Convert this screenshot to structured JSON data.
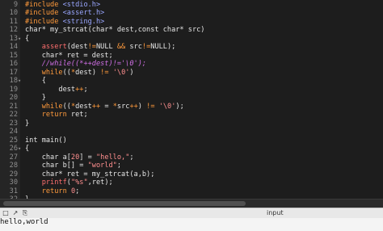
{
  "editor": {
    "lines": [
      {
        "n": "9",
        "fold": "",
        "tokens": [
          [
            "pre",
            "#include "
          ],
          [
            "inc",
            "<stdio.h>"
          ]
        ]
      },
      {
        "n": "10",
        "fold": "",
        "tokens": [
          [
            "pre",
            "#include "
          ],
          [
            "inc",
            "<assert.h>"
          ]
        ]
      },
      {
        "n": "11",
        "fold": "",
        "tokens": [
          [
            "pre",
            "#include "
          ],
          [
            "inc",
            "<string.h>"
          ]
        ]
      },
      {
        "n": "12",
        "fold": "",
        "tokens": [
          [
            "plain",
            "char* my_strcat(char* dest,const char* src)"
          ]
        ]
      },
      {
        "n": "13",
        "fold": "▾",
        "tokens": [
          [
            "plain",
            "{"
          ]
        ]
      },
      {
        "n": "14",
        "fold": "",
        "tokens": [
          [
            "plain",
            "    "
          ],
          [
            "fn",
            "assert"
          ],
          [
            "plain",
            "(dest"
          ],
          [
            "kw",
            "!="
          ],
          [
            "plain",
            "NULL "
          ],
          [
            "kw",
            "&&"
          ],
          [
            "plain",
            " src"
          ],
          [
            "kw",
            "!="
          ],
          [
            "plain",
            "NULL);"
          ]
        ]
      },
      {
        "n": "15",
        "fold": "",
        "tokens": [
          [
            "plain",
            "    char* ret = dest;"
          ]
        ]
      },
      {
        "n": "16",
        "fold": "",
        "tokens": [
          [
            "plain",
            "    "
          ],
          [
            "cmt",
            "//while((*++dest)!='\\0');"
          ]
        ]
      },
      {
        "n": "17",
        "fold": "",
        "tokens": [
          [
            "plain",
            "    "
          ],
          [
            "kw",
            "while"
          ],
          [
            "plain",
            "(("
          ],
          [
            "kw",
            "*"
          ],
          [
            "plain",
            "dest) "
          ],
          [
            "kw",
            "!="
          ],
          [
            "plain",
            " "
          ],
          [
            "str",
            "'\\0'"
          ],
          [
            "plain",
            ")"
          ]
        ]
      },
      {
        "n": "18",
        "fold": "▾",
        "tokens": [
          [
            "plain",
            "    {"
          ]
        ]
      },
      {
        "n": "19",
        "fold": "",
        "tokens": [
          [
            "plain",
            "        dest"
          ],
          [
            "kw",
            "++"
          ],
          [
            "plain",
            ";"
          ]
        ]
      },
      {
        "n": "20",
        "fold": "",
        "tokens": [
          [
            "plain",
            "    }"
          ]
        ]
      },
      {
        "n": "21",
        "fold": "",
        "tokens": [
          [
            "plain",
            "    "
          ],
          [
            "kw",
            "while"
          ],
          [
            "plain",
            "(("
          ],
          [
            "kw",
            "*"
          ],
          [
            "plain",
            "dest"
          ],
          [
            "kw",
            "++"
          ],
          [
            "plain",
            " = "
          ],
          [
            "kw",
            "*"
          ],
          [
            "plain",
            "src"
          ],
          [
            "kw",
            "++"
          ],
          [
            "plain",
            ") "
          ],
          [
            "kw",
            "!="
          ],
          [
            "plain",
            " "
          ],
          [
            "str",
            "'\\0'"
          ],
          [
            "plain",
            ");"
          ]
        ]
      },
      {
        "n": "22",
        "fold": "",
        "tokens": [
          [
            "plain",
            "    "
          ],
          [
            "kw",
            "return"
          ],
          [
            "plain",
            " ret;"
          ]
        ]
      },
      {
        "n": "23",
        "fold": "",
        "tokens": [
          [
            "plain",
            "}"
          ]
        ]
      },
      {
        "n": "24",
        "fold": "",
        "tokens": []
      },
      {
        "n": "25",
        "fold": "",
        "tokens": [
          [
            "plain",
            "int main()"
          ]
        ]
      },
      {
        "n": "26",
        "fold": "▾",
        "tokens": [
          [
            "plain",
            "{"
          ]
        ]
      },
      {
        "n": "27",
        "fold": "",
        "tokens": [
          [
            "plain",
            "    char a["
          ],
          [
            "num",
            "20"
          ],
          [
            "plain",
            "] = "
          ],
          [
            "str",
            "\"hello,\""
          ],
          [
            "plain",
            ";"
          ]
        ]
      },
      {
        "n": "28",
        "fold": "",
        "tokens": [
          [
            "plain",
            "    char b[] = "
          ],
          [
            "str",
            "\"world\""
          ],
          [
            "plain",
            ";"
          ]
        ]
      },
      {
        "n": "29",
        "fold": "",
        "tokens": [
          [
            "plain",
            "    char* ret = my_strcat(a,b);"
          ]
        ]
      },
      {
        "n": "30",
        "fold": "",
        "tokens": [
          [
            "plain",
            "    "
          ],
          [
            "fn",
            "printf"
          ],
          [
            "plain",
            "("
          ],
          [
            "str",
            "\"%s\""
          ],
          [
            "plain",
            ",ret);"
          ]
        ]
      },
      {
        "n": "31",
        "fold": "",
        "tokens": [
          [
            "plain",
            "    "
          ],
          [
            "kw",
            "return"
          ],
          [
            "plain",
            " "
          ],
          [
            "num",
            "0"
          ],
          [
            "plain",
            ";"
          ]
        ]
      },
      {
        "n": "32",
        "fold": "",
        "tokens": [
          [
            "plain",
            "}"
          ]
        ]
      },
      {
        "n": "33",
        "fold": "",
        "tokens": []
      }
    ]
  },
  "toolbar": {
    "icons": [
      "expand-icon",
      "collapse-icon",
      "copy-icon"
    ],
    "label": "input"
  },
  "output": {
    "text": "hello,world"
  }
}
